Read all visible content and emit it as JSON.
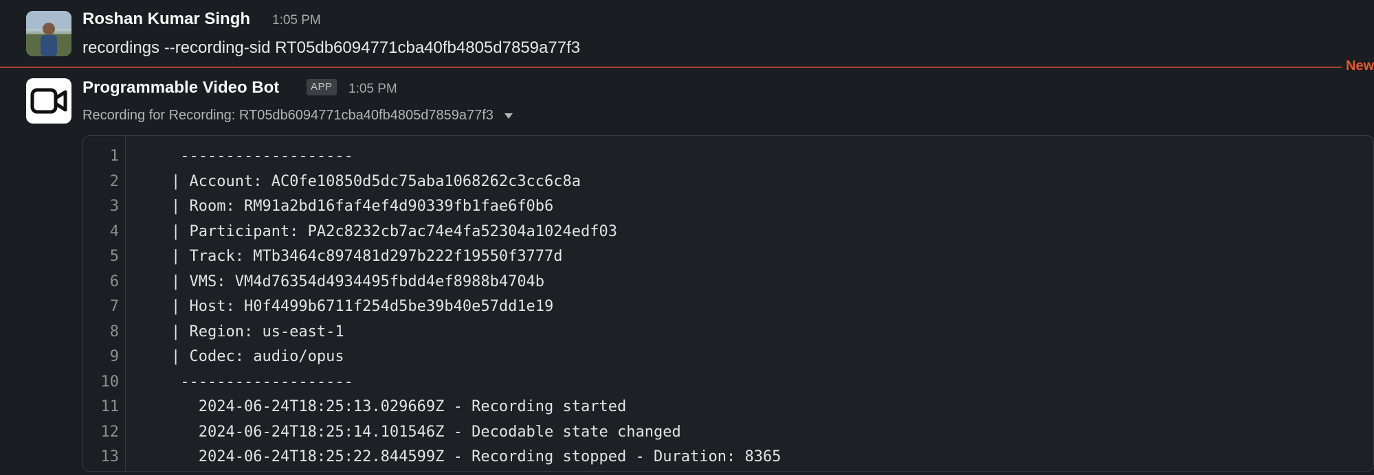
{
  "messages": [
    {
      "author": "Roshan Kumar Singh",
      "time": "1:05 PM",
      "text": "recordings --recording-sid RT05db6094771cba40fb4805d7859a77f3",
      "avatar": "user-photo"
    },
    {
      "author": "Programmable Video Bot",
      "badge": "APP",
      "time": "1:05 PM",
      "subtitle": "Recording for Recording: RT05db6094771cba40fb4805d7859a77f3",
      "avatar_icon": "video-camera-icon"
    }
  ],
  "divider": {
    "label": "New",
    "color": "#e5562f"
  },
  "code_lines": [
    {
      "num": "1",
      "text": " -------------------"
    },
    {
      "num": "2",
      "text": "| Account: AC0fe10850d5dc75aba1068262c3cc6c8a"
    },
    {
      "num": "3",
      "text": "| Room: RM91a2bd16faf4ef4d90339fb1fae6f0b6"
    },
    {
      "num": "4",
      "text": "| Participant: PA2c8232cb7ac74e4fa52304a1024edf03"
    },
    {
      "num": "5",
      "text": "| Track: MTb3464c897481d297b222f19550f3777d"
    },
    {
      "num": "6",
      "text": "| VMS: VM4d76354d4934495fbdd4ef8988b4704b"
    },
    {
      "num": "7",
      "text": "| Host: H0f4499b6711f254d5be39b40e57dd1e19"
    },
    {
      "num": "8",
      "text": "| Region: us-east-1"
    },
    {
      "num": "9",
      "text": "| Codec: audio/opus"
    },
    {
      "num": "10",
      "text": " -------------------"
    },
    {
      "num": "11",
      "text": "   2024-06-24T18:25:13.029669Z - Recording started"
    },
    {
      "num": "12",
      "text": "   2024-06-24T18:25:14.101546Z - Decodable state changed"
    },
    {
      "num": "13",
      "text": "   2024-06-24T18:25:22.844599Z - Recording stopped - Duration: 8365"
    }
  ]
}
